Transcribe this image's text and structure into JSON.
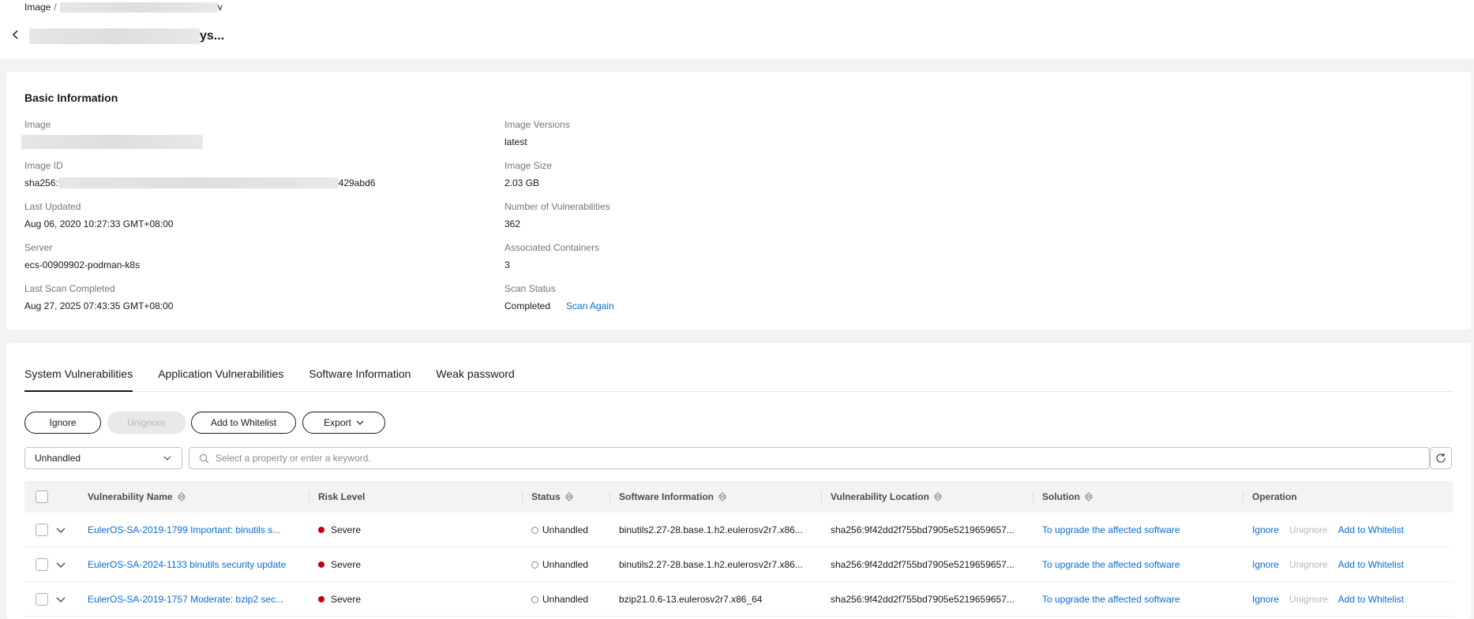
{
  "breadcrumb": {
    "root": "Image",
    "separator": "/",
    "tail": "v"
  },
  "page": {
    "title_suffix": "ys..."
  },
  "basic": {
    "section_title": "Basic Information",
    "left": [
      {
        "label": "Image",
        "value": ""
      },
      {
        "label": "Image ID",
        "value_prefix": "sha256:",
        "value_suffix": "429abd6"
      },
      {
        "label": "Last Updated",
        "value": "Aug 06, 2020 10:27:33 GMT+08:00"
      },
      {
        "label": "Server",
        "value": "ecs-00909902-podman-k8s"
      },
      {
        "label": "Last Scan Completed",
        "value": "Aug 27, 2025 07:43:35 GMT+08:00"
      }
    ],
    "right": [
      {
        "label": "Image Versions",
        "value": "latest"
      },
      {
        "label": "Image Size",
        "value": "2.03 GB"
      },
      {
        "label": "Number of Vulnerabilities",
        "value": "362"
      },
      {
        "label": "Associated Containers",
        "value": "3"
      },
      {
        "label": "Scan Status",
        "value": "Completed",
        "action": "Scan Again"
      }
    ]
  },
  "tabs": [
    "System Vulnerabilities",
    "Application Vulnerabilities",
    "Software Information",
    "Weak password"
  ],
  "toolbar": {
    "ignore": "Ignore",
    "unignore": "Unignore",
    "whitelist": "Add to Whitelist",
    "export": "Export"
  },
  "filter": {
    "selected": "Unhandled"
  },
  "search": {
    "placeholder": "Select a property or enter a keyword."
  },
  "table": {
    "columns": [
      "Vulnerability Name",
      "Risk Level",
      "Status",
      "Software Information",
      "Vulnerability Location",
      "Solution",
      "Operation"
    ],
    "rows": [
      {
        "name": "EulerOS-SA-2019-1799 Important: binutils s...",
        "risk": "Severe",
        "status": "Unhandled",
        "software": "binutils2.27-28.base.1.h2.eulerosv2r7.x86...",
        "location": "sha256:9f42dd2f755bd7905e5219659657...",
        "solution": "To upgrade the affected software",
        "ops": [
          "Ignore",
          "Unignore",
          "Add to Whitelist"
        ]
      },
      {
        "name": "EulerOS-SA-2024-1133 binutils security update",
        "risk": "Severe",
        "status": "Unhandled",
        "software": "binutils2.27-28.base.1.h2.eulerosv2r7.x86...",
        "location": "sha256:9f42dd2f755bd7905e5219659657...",
        "solution": "To upgrade the affected software",
        "ops": [
          "Ignore",
          "Unignore",
          "Add to Whitelist"
        ]
      },
      {
        "name": "EulerOS-SA-2019-1757 Moderate: bzip2 sec...",
        "risk": "Severe",
        "status": "Unhandled",
        "software": "bzip21.0.6-13.eulerosv2r7.x86_64",
        "location": "sha256:9f42dd2f755bd7905e5219659657...",
        "solution": "To upgrade the affected software",
        "ops": [
          "Ignore",
          "Unignore",
          "Add to Whitelist"
        ]
      }
    ]
  },
  "colors": {
    "link": "#0a6cd6",
    "severe": "#c7000b",
    "text": "#191919"
  },
  "icons": {
    "back": "chevron-left-icon",
    "sort": "sort-icon",
    "search": "search-icon",
    "refresh": "refresh-icon",
    "expand": "chevron-down-icon"
  }
}
